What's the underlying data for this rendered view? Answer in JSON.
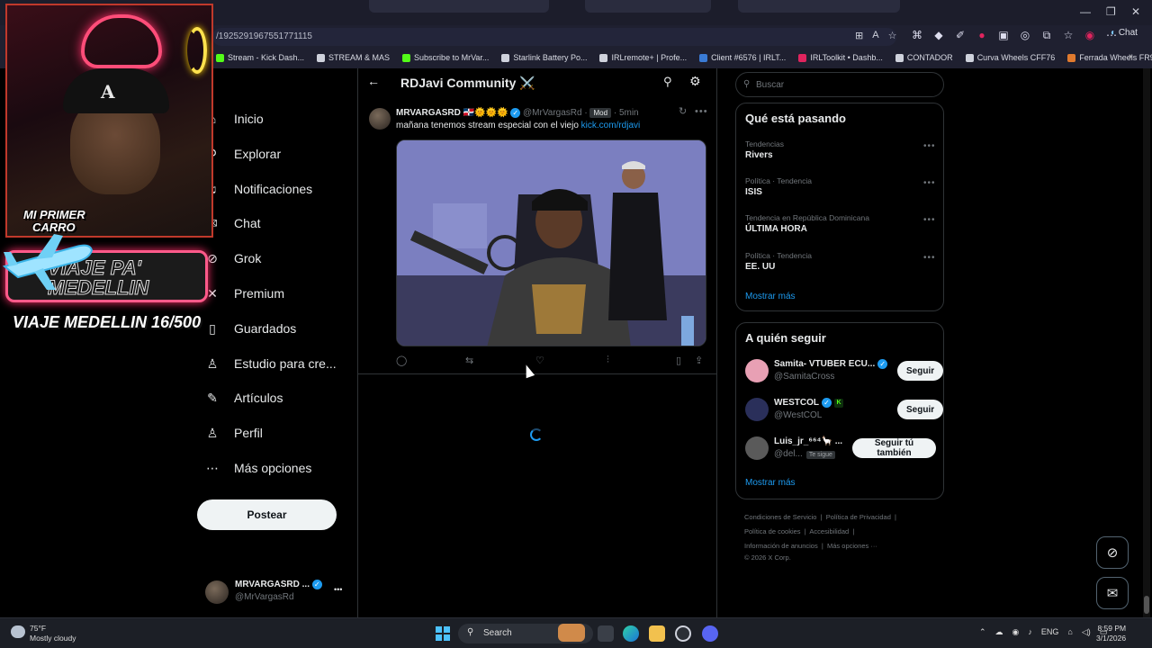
{
  "browser": {
    "url": "/1925291967551771115",
    "chat_label": "Chat",
    "bookmarks": [
      {
        "label": "Stream - Kick Dash...",
        "color": "#53fc18"
      },
      {
        "label": "STREAM & MAS",
        "color": "#cfd2dc"
      },
      {
        "label": "Subscribe to MrVar...",
        "color": "#53fc18"
      },
      {
        "label": "Starlink Battery Po...",
        "color": "#cfd2dc"
      },
      {
        "label": "IRLremote+ | Profe...",
        "color": "#cfd2dc"
      },
      {
        "label": "Client #6576 | IRLT...",
        "color": "#3a7bd5"
      },
      {
        "label": "IRLToolkit • Dashb...",
        "color": "#e0245e"
      },
      {
        "label": "CONTADOR",
        "color": "#cfd2dc"
      },
      {
        "label": "Curva Wheels CFF76",
        "color": "#cfd2dc"
      },
      {
        "label": "Ferrada Wheels FR9",
        "color": "#e07a2e"
      }
    ]
  },
  "nav": {
    "items": [
      {
        "label": "Inicio",
        "icon": "home-icon",
        "glyph": "⌂"
      },
      {
        "label": "Explorar",
        "icon": "search-icon",
        "glyph": "⚲"
      },
      {
        "label": "Notificaciones",
        "icon": "bell-icon",
        "glyph": "♫"
      },
      {
        "label": "Chat",
        "icon": "chat-icon",
        "glyph": "✉"
      },
      {
        "label": "Grok",
        "icon": "grok-icon",
        "glyph": "⊘"
      },
      {
        "label": "Premium",
        "icon": "x-logo-icon",
        "glyph": "✕"
      },
      {
        "label": "Guardados",
        "icon": "bookmark-icon",
        "glyph": "▯"
      },
      {
        "label": "Estudio para cre...",
        "icon": "studio-icon",
        "glyph": "♙"
      },
      {
        "label": "Artículos",
        "icon": "articles-icon",
        "glyph": "✎"
      },
      {
        "label": "Perfil",
        "icon": "person-icon",
        "glyph": "♙"
      },
      {
        "label": "Más opciones",
        "icon": "more-options-icon",
        "glyph": "⋯"
      }
    ],
    "post_button": "Postear"
  },
  "account": {
    "name": "MRVARGASRD ...",
    "handle": "@MrVargasRd",
    "more": "•••"
  },
  "header": {
    "title": "RDJavi Community ⚔️"
  },
  "post": {
    "author_name": "MRVARGASRD 🇩🇴🌞🌞🌞",
    "author_handle": "@MrVargasRd",
    "badge": "Mod",
    "separator": "·",
    "time": "5min",
    "text": "mañana tenemos stream especial con el viejo ",
    "link": "kick.com/rdjavi",
    "more": "•••"
  },
  "search": {
    "placeholder": "Buscar"
  },
  "trends": {
    "title": "Qué está pasando",
    "items": [
      {
        "meta": "Tendencias",
        "name": "Rivers"
      },
      {
        "meta": "Política · Tendencia",
        "name": "ISIS"
      },
      {
        "meta": "Tendencia en República Dominicana",
        "name": "ÚLTIMA HORA"
      },
      {
        "meta": "Política · Tendencia",
        "name": "EE. UU"
      }
    ],
    "more_dots": "•••",
    "show_more": "Mostrar más"
  },
  "who_to_follow": {
    "title": "A quién seguir",
    "items": [
      {
        "name": "Samita- VTUBER ECU...",
        "handle": "@SamitaCross",
        "button": "Seguir",
        "avatar_color": "#e8a0b4"
      },
      {
        "name": "WESTCOL",
        "handle": "@WestCOL",
        "button": "Seguir",
        "avatar_color": "#2a2f5a"
      },
      {
        "name": "Luis_jr_⁶⁶⁴🦙 ...",
        "handle": "@del...",
        "follows_you": "Te sigue",
        "button": "Seguir tú también",
        "avatar_color": "#5a5a5a"
      }
    ],
    "show_more": "Mostrar más"
  },
  "footer": {
    "line1": [
      "Condiciones de Servicio",
      "Política de Privacidad"
    ],
    "line2": [
      "Política de cookies",
      "Accesibilidad"
    ],
    "line3": [
      "Información de anuncios",
      "Más opciones ···"
    ],
    "copyright": "© 2026 X Corp."
  },
  "overlay": {
    "carro_label_1": "MI PRIMER",
    "carro_label_2": "CARRO",
    "banner_1": "VIAJE PA'",
    "banner_2": "MEDELLIN",
    "counter": "VIAJE MEDELLIN 16/500"
  },
  "taskbar": {
    "temperature": "75°F",
    "weather": "Mostly cloudy",
    "search": "Search",
    "language": "ENG",
    "time": "8:59 PM",
    "date": "3/1/2026"
  }
}
